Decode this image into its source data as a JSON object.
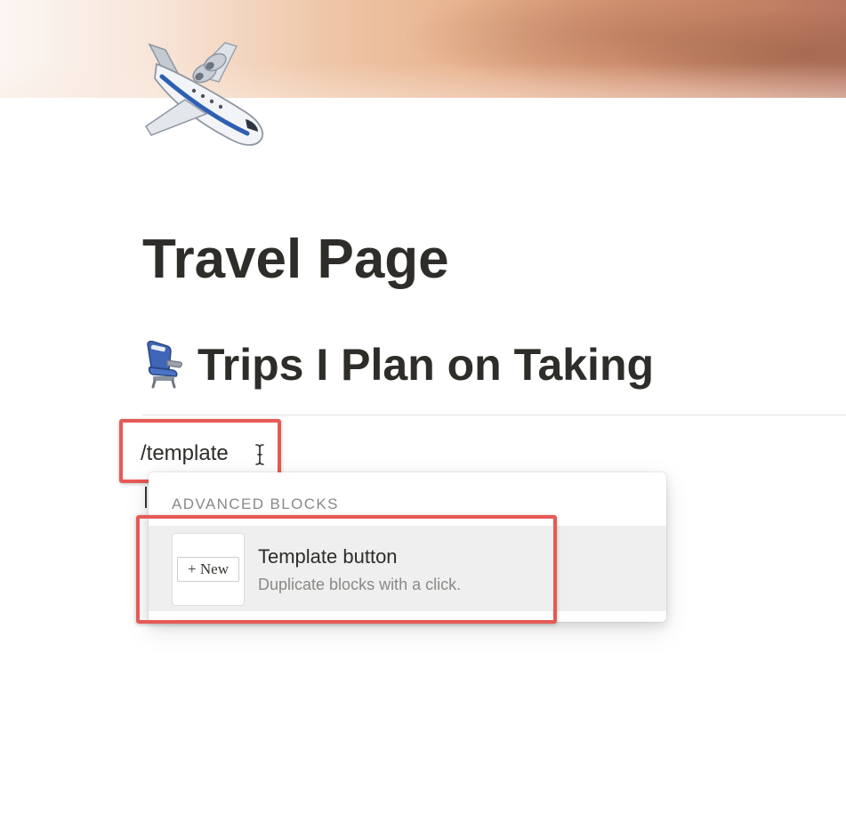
{
  "page": {
    "title": "Travel Page",
    "icon": "airplane-icon"
  },
  "section": {
    "heading": "Trips I Plan on Taking",
    "icon": "seat-icon"
  },
  "editor": {
    "slash_command_text": "/template"
  },
  "slash_menu": {
    "section_label": "ADVANCED BLOCKS",
    "items": [
      {
        "title": "Template button",
        "description": "Duplicate blocks with a click.",
        "thumbnail_label": "+ New"
      }
    ]
  },
  "colors": {
    "annotation_red": "#e65a55",
    "text_primary": "#2f2d29",
    "text_secondary": "#8b8985",
    "menu_hover": "#efefef"
  }
}
